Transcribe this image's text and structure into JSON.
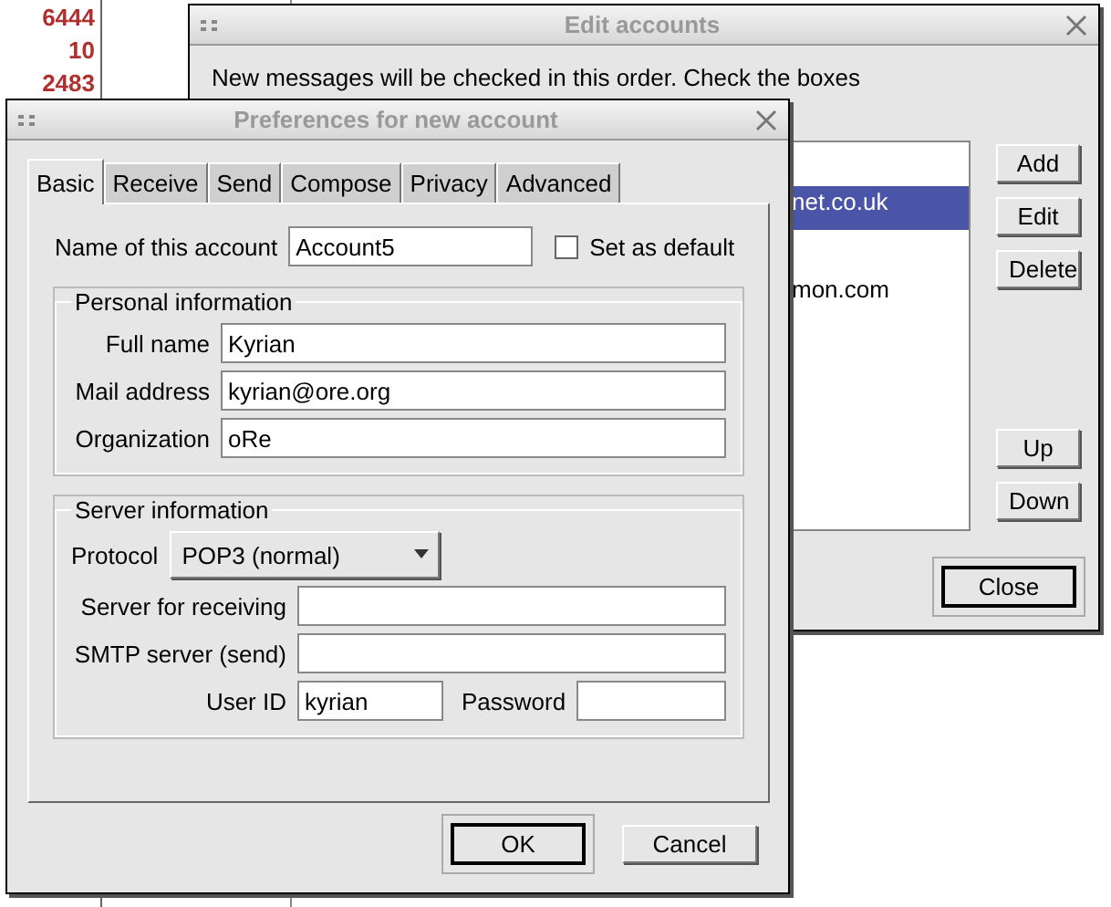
{
  "background_window": {
    "numbers": [
      "6444",
      "10",
      "2483"
    ]
  },
  "edit_accounts": {
    "title": "Edit accounts",
    "message": "New messages will be checked in this order. Check the boxes",
    "accounts": [
      {
        "label": "net.co.uk",
        "selected": true
      },
      {
        "label": "mon.com",
        "selected": false
      }
    ],
    "side_buttons": [
      "Add",
      "Edit",
      "Delete"
    ],
    "order_buttons": [
      "Up",
      "Down"
    ],
    "close_button": "Close"
  },
  "preferences": {
    "title": "Preferences for new account",
    "tabs": [
      {
        "label": "Basic",
        "selected": true
      },
      {
        "label": "Receive",
        "selected": false
      },
      {
        "label": "Send",
        "selected": false
      },
      {
        "label": "Compose",
        "selected": false
      },
      {
        "label": "Privacy",
        "selected": false
      },
      {
        "label": "Advanced",
        "selected": false
      }
    ],
    "account_name": {
      "label": "Name of this account",
      "value": "Account5"
    },
    "set_as_default": {
      "label": "Set as default",
      "checked": false
    },
    "personal": {
      "title": "Personal information",
      "fields": [
        {
          "label": "Full name",
          "value": "Kyrian"
        },
        {
          "label": "Mail address",
          "value": "kyrian@ore.org"
        },
        {
          "label": "Organization",
          "value": "oRe"
        }
      ]
    },
    "server": {
      "title": "Server information",
      "protocol": {
        "label": "Protocol",
        "value": "POP3 (normal)"
      },
      "fields": [
        {
          "label": "Server for receiving"
        },
        {
          "label": "SMTP server (send)"
        }
      ],
      "user_id": {
        "label": "User ID",
        "value": "kyrian"
      },
      "password": {
        "label": "Password"
      }
    },
    "buttons": [
      {
        "label": "OK",
        "default": true
      },
      {
        "label": "Cancel",
        "default": false
      }
    ]
  }
}
